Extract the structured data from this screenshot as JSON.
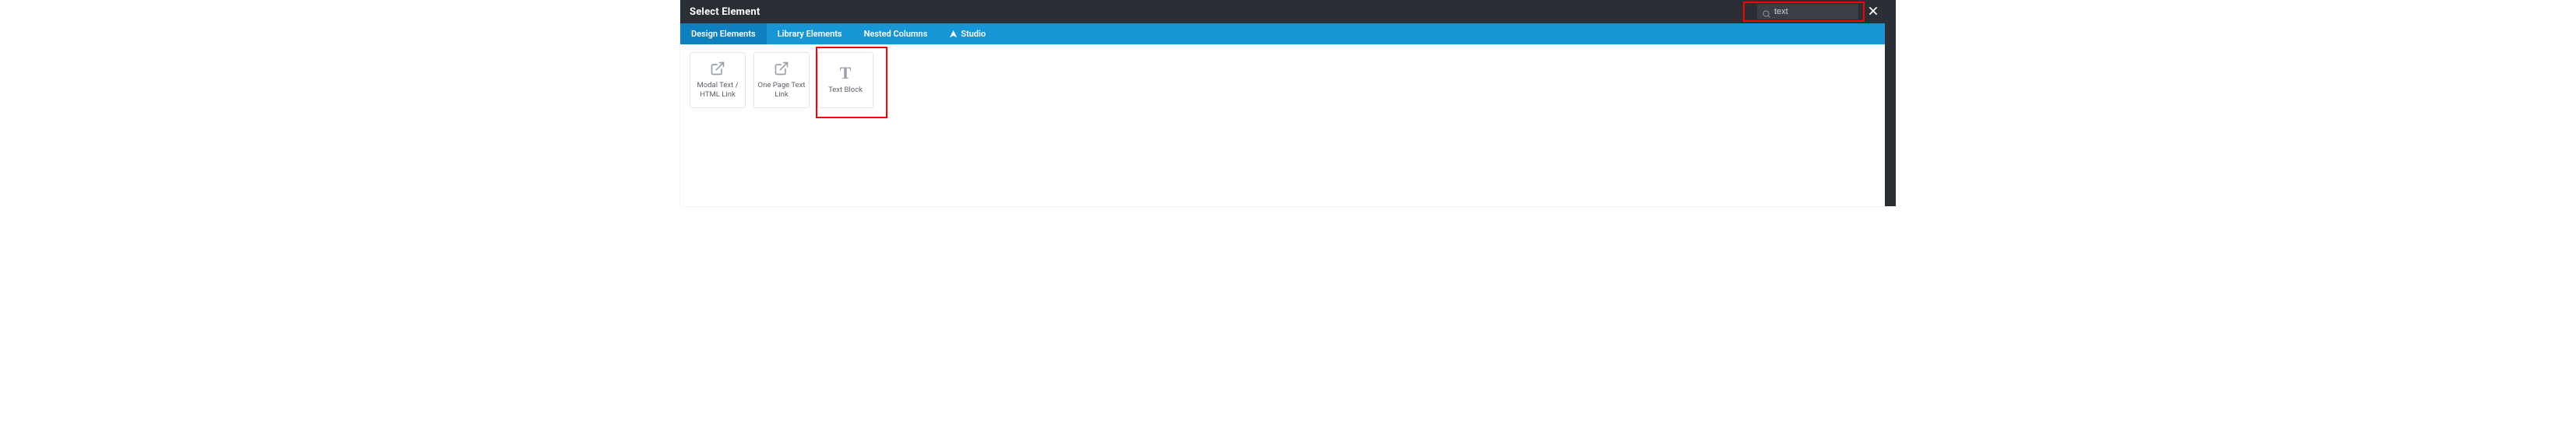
{
  "header": {
    "title": "Select Element",
    "search_value": "text",
    "search_placeholder": ""
  },
  "tabs": [
    {
      "label": "Design Elements",
      "active": true
    },
    {
      "label": "Library Elements",
      "active": false
    },
    {
      "label": "Nested Columns",
      "active": false
    },
    {
      "label": "Studio",
      "active": false,
      "icon": "studio"
    }
  ],
  "cards": [
    {
      "icon": "external-link",
      "label": "Modal Text / HTML Link"
    },
    {
      "icon": "external-link",
      "label": "One Page Text Link"
    },
    {
      "icon": "text-t",
      "label": "Text Block"
    }
  ],
  "highlights": {
    "search_box": true,
    "text_block_card": true
  },
  "colors": {
    "header_bg": "#2a2e35",
    "tab_bar_bg": "#1795d4",
    "tab_active_bg": "#0e7fbf",
    "highlight": "#ff0000"
  }
}
